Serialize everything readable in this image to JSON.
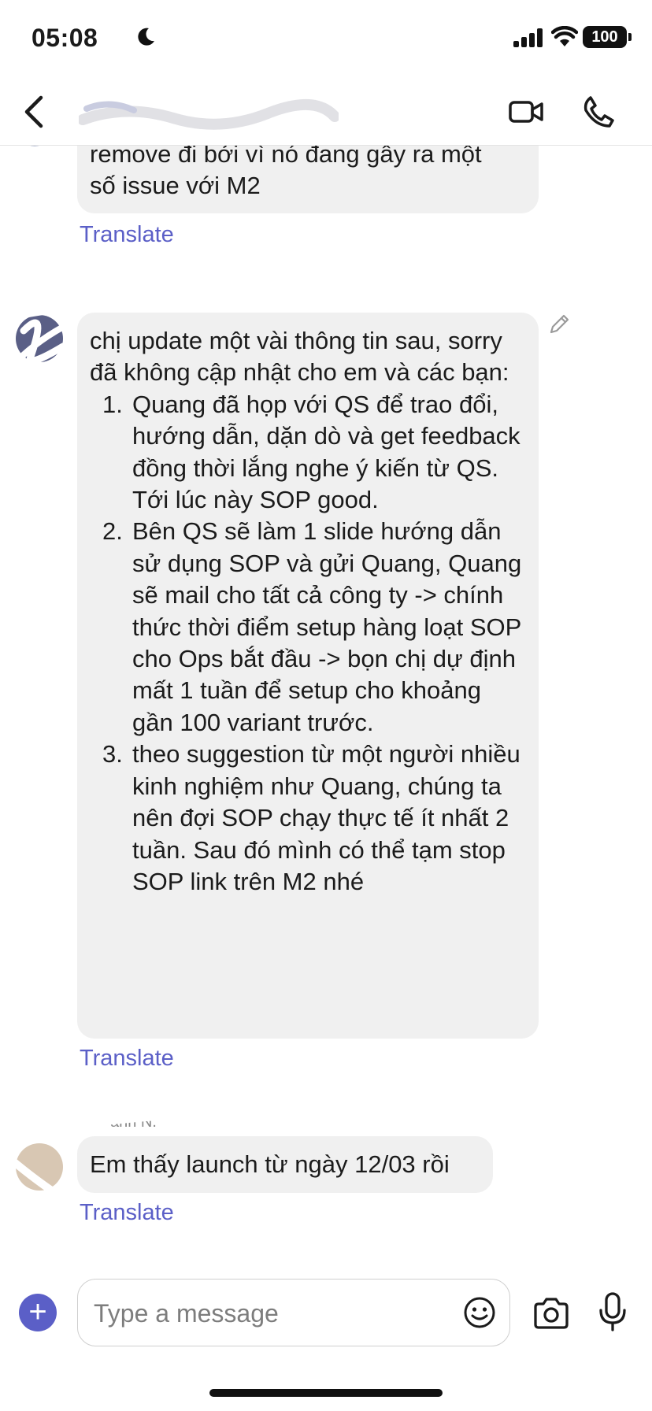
{
  "status_bar": {
    "time": "05:08",
    "battery": "100"
  },
  "messages": [
    {
      "text_lines": [
        "remove đi bởi vì nó đang gây ra một",
        "số issue với M2"
      ],
      "translate": "Translate"
    },
    {
      "intro": "chị update một vài thông tin sau, sorry đã không cập nhật cho em và các bạn:",
      "items": [
        {
          "num": "1.",
          "text": "Quang đã họp với QS để trao đổi, hướng dẫn, dặn dò và get feedback đồng thời lắng nghe ý kiến từ QS. Tới lúc này SOP good."
        },
        {
          "num": "2.",
          "text": "Bên QS sẽ làm 1 slide hướng dẫn sử dụng SOP và gửi Quang, Quang sẽ mail cho tất cả công ty -> chính thức thời điểm setup hàng loạt SOP cho Ops bắt đầu -> bọn chị dự định mất 1 tuần để setup cho khoảng gần 100 variant trước."
        },
        {
          "num": "3.",
          "text": "theo suggestion từ một người nhiều kinh nghiệm như Quang, chúng ta nên đợi SOP chạy thực tế ít nhất 2 tuần. Sau đó mình có thể tạm stop SOP link trên M2 nhé"
        }
      ],
      "translate": "Translate"
    },
    {
      "sender": "ann N.",
      "text": "Em thấy launch từ ngày 12/03 rồi",
      "translate": "Translate"
    }
  ],
  "compose": {
    "placeholder": "Type a message",
    "add_label": "+"
  },
  "icons": [
    "moon-icon",
    "signal-icon",
    "wifi-icon",
    "battery-icon",
    "back-icon",
    "video-call-icon",
    "phone-icon",
    "edit-icon",
    "add-icon",
    "emoji-icon",
    "camera-icon",
    "mic-icon"
  ],
  "colors": {
    "accent": "#5b5fc7",
    "bubble": "#f0f0f0"
  }
}
